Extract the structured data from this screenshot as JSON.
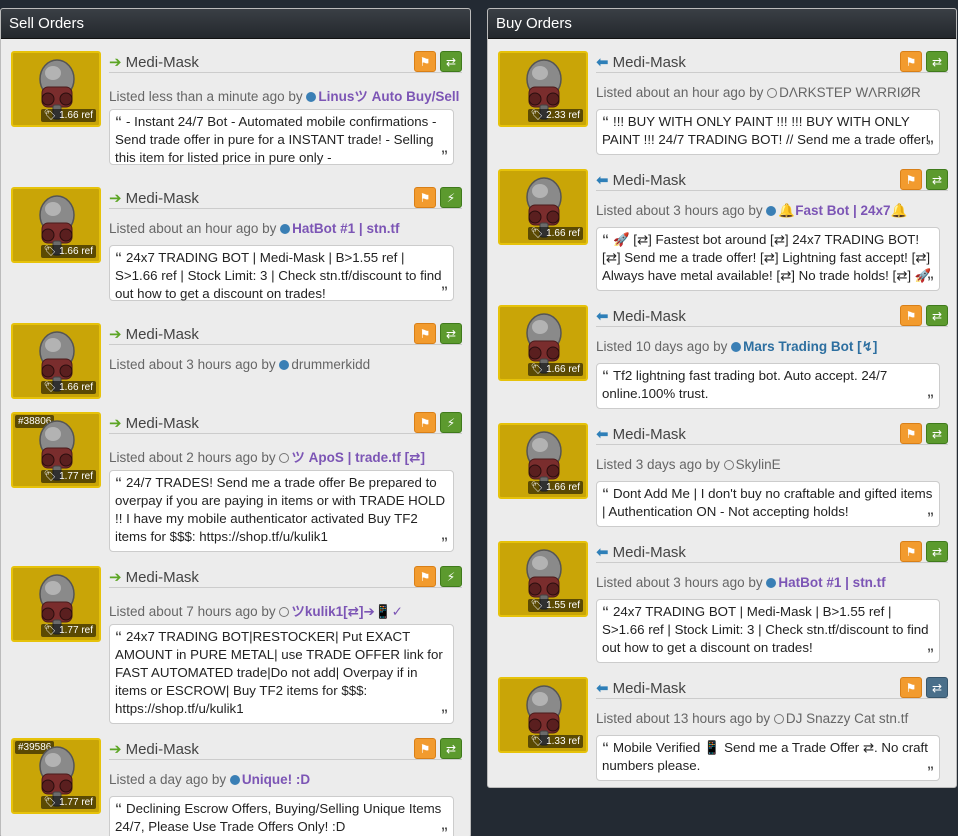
{
  "sell": {
    "title": "Sell Orders",
    "listings": [
      {
        "item": "Medi-Mask",
        "price": "1.66 ref",
        "id_tag": "",
        "listed": "Listed less than a minute ago by",
        "user": "Linusツ Auto Buy/Sell",
        "user_style": "premium",
        "status": "online",
        "trade_icon": "trade-arrows",
        "comment": "- Instant 24/7 Bot - Automated mobile confirmations - Send trade offer in pure for a INSTANT trade! - Selling this item for listed price in pure only -"
      },
      {
        "item": "Medi-Mask",
        "price": "1.66 ref",
        "id_tag": "",
        "listed": "Listed about an hour ago by",
        "user": "HatBot #1 | stn.tf",
        "user_style": "premium",
        "status": "online",
        "trade_icon": "lightning",
        "comment": "24x7 TRADING BOT | Medi-Mask | B>1.55 ref | S>1.66 ref | Stock Limit: 3 | Check stn.tf/discount to find out how to get a discount on trades!"
      },
      {
        "item": "Medi-Mask",
        "price": "1.66 ref",
        "id_tag": "",
        "listed": "Listed about 3 hours ago by",
        "user": "drummerkidd",
        "user_style": "plain",
        "status": "online",
        "trade_icon": "trade-arrows",
        "comment": ""
      },
      {
        "item": "Medi-Mask",
        "price": "1.77 ref",
        "id_tag": "#38806",
        "listed": "Listed about 2 hours ago by",
        "user": "ツ ApoS | trade.tf [⇄]",
        "user_style": "premium",
        "status": "offline",
        "trade_icon": "lightning",
        "comment": "24/7 TRADES! Send me a trade offer Be prepared to overpay if you are paying in items or with TRADE HOLD !! I have my mobile authenticator activated Buy TF2 items for $$$: https://shop.tf/u/kulik1"
      },
      {
        "item": "Medi-Mask",
        "price": "1.77 ref",
        "id_tag": "",
        "listed": "Listed about 7 hours ago by",
        "user": "ツkulik1[⇄]➔📱✓",
        "user_style": "premium",
        "status": "offline",
        "trade_icon": "lightning",
        "comment": "24x7 TRADING BOT|RESTOCKER| Put EXACT AMOUNT in PURE METAL| use TRADE OFFER link for FAST AUTOMATED trade|Do not add| Overpay if in items or ESCROW| Buy TF2 items for $$$: https://shop.tf/u/kulik1"
      },
      {
        "item": "Medi-Mask",
        "price": "1.77 ref",
        "id_tag": "#39586",
        "listed": "Listed a day ago by",
        "user": "Unique! :D",
        "user_style": "premium",
        "status": "online",
        "trade_icon": "trade-arrows",
        "comment": "Declining Escrow Offers, Buying/Selling Unique Items 24/7, Please Use Trade Offers Only! :D"
      }
    ]
  },
  "buy": {
    "title": "Buy Orders",
    "listings": [
      {
        "item": "Medi-Mask",
        "price": "2.33 ref",
        "id_tag": "",
        "listed": "Listed about an hour ago by",
        "user": "DΛRKSTEP WΛRRIØR",
        "user_style": "plain",
        "status": "offline",
        "trade_icon": "trade-arrows",
        "comment": "!!! BUY WITH ONLY PAINT !!! !!! BUY WITH ONLY PAINT !!! 24/7 TRADING BOT! // Send me a trade offer!"
      },
      {
        "item": "Medi-Mask",
        "price": "1.66 ref",
        "id_tag": "",
        "listed": "Listed about 3 hours ago by",
        "user": "🔔Fast Bot | 24x7🔔",
        "user_style": "premium",
        "status": "online",
        "trade_icon": "trade-arrows",
        "comment": "🚀 [⇄] Fastest bot around [⇄] 24x7 TRADING BOT! [⇄] Send me a trade offer! [⇄] Lightning fast accept! [⇄] Always have metal available! [⇄] No trade holds! [⇄] 🚀"
      },
      {
        "item": "Medi-Mask",
        "price": "1.66 ref",
        "id_tag": "",
        "listed": "Listed 10 days ago by",
        "user": "Mars Trading Bot [↯]",
        "user_style": "premium-blue",
        "status": "online",
        "trade_icon": "trade-arrows",
        "comment": "Tf2 lightning fast trading bot. Auto accept. 24/7 online.100% trust."
      },
      {
        "item": "Medi-Mask",
        "price": "1.66 ref",
        "id_tag": "",
        "listed": "Listed 3 days ago by",
        "user": "SkylinE",
        "user_style": "plain",
        "status": "offline",
        "trade_icon": "trade-arrows",
        "comment": "Dont Add Me | I don't buy no craftable and gifted items | Authentication ON - Not accepting holds!"
      },
      {
        "item": "Medi-Mask",
        "price": "1.55 ref",
        "id_tag": "",
        "listed": "Listed about 3 hours ago by",
        "user": "HatBot #1 | stn.tf",
        "user_style": "premium",
        "status": "online",
        "trade_icon": "trade-arrows",
        "comment": "24x7 TRADING BOT | Medi-Mask | B>1.55 ref | S>1.66 ref | Stock Limit: 3 | Check stn.tf/discount to find out how to get a discount on trades!"
      },
      {
        "item": "Medi-Mask",
        "price": "1.33 ref",
        "id_tag": "",
        "listed": "Listed about 13 hours ago by",
        "user": "DJ Snazzy Cat stn.tf",
        "user_style": "plain",
        "status": "offline",
        "trade_icon": "trade-arrows-blue",
        "comment": "Mobile Verified 📱 Send me a Trade Offer ⇄. No craft numbers please."
      }
    ]
  }
}
